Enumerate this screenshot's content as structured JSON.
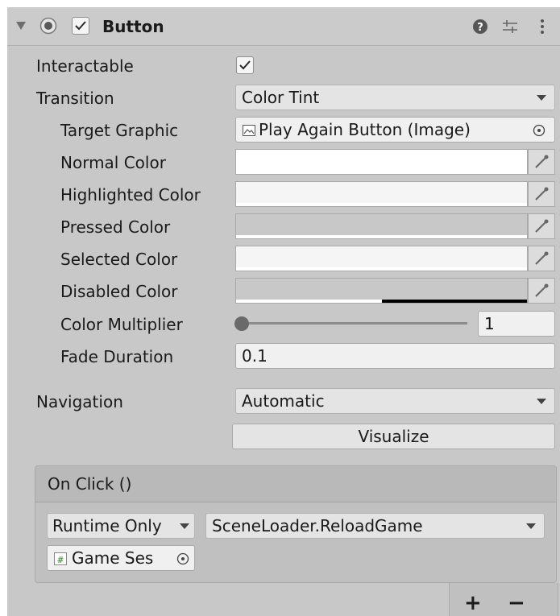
{
  "component": {
    "title": "Button",
    "enabled": true
  },
  "fields": {
    "interactable": {
      "label": "Interactable",
      "checked": true
    },
    "transition": {
      "label": "Transition",
      "value": "Color Tint"
    },
    "target_graphic": {
      "label": "Target Graphic",
      "value": "Play Again Button (Image)"
    },
    "normal_color": {
      "label": "Normal Color",
      "color": "#ffffff",
      "alpha": 1.0
    },
    "highlighted_color": {
      "label": "Highlighted Color",
      "color": "#f5f5f5",
      "alpha": 1.0
    },
    "pressed_color": {
      "label": "Pressed Color",
      "color": "#c8c8c8",
      "alpha": 1.0
    },
    "selected_color": {
      "label": "Selected Color",
      "color": "#f5f5f5",
      "alpha": 1.0
    },
    "disabled_color": {
      "label": "Disabled Color",
      "color": "#c8c8c8",
      "alpha": 0.5
    },
    "color_multiplier": {
      "label": "Color Multiplier",
      "value": "1",
      "slider_fraction": 0.0
    },
    "fade_duration": {
      "label": "Fade Duration",
      "value": "0.1"
    },
    "navigation": {
      "label": "Navigation",
      "value": "Automatic"
    },
    "visualize": {
      "label": "Visualize"
    }
  },
  "on_click": {
    "title": "On Click ()",
    "runtime": "Runtime Only",
    "function": "SceneLoader.ReloadGame",
    "target": "Game Ses",
    "add_label": "+",
    "remove_label": "−"
  },
  "colors": {
    "panel_bg": "#c8c8c8",
    "field_bg": "#f0f0f0",
    "dropdown_bg": "#e4e4e4"
  }
}
